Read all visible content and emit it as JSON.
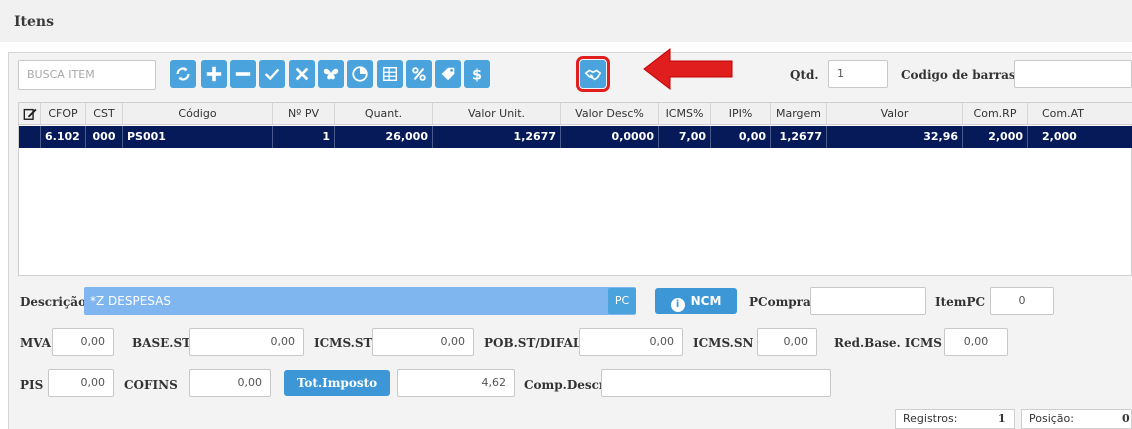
{
  "window": {
    "title": "Itens"
  },
  "toolbar": {
    "search_placeholder": "BUSCA ITEM",
    "buttons": [
      {
        "name": "refresh",
        "glyph": "⟳"
      },
      {
        "name": "add",
        "glyph": "+"
      },
      {
        "name": "remove",
        "glyph": "−"
      },
      {
        "name": "confirm",
        "glyph": "✓"
      },
      {
        "name": "cancel",
        "glyph": "✕"
      },
      {
        "name": "butterfly",
        "glyph": "⋈"
      },
      {
        "name": "chart",
        "glyph": "◔"
      },
      {
        "name": "excel",
        "glyph": "▤"
      },
      {
        "name": "percent",
        "glyph": "%"
      },
      {
        "name": "tag",
        "glyph": "◈"
      },
      {
        "name": "dollar",
        "glyph": "$"
      },
      {
        "name": "handshake",
        "glyph": "⚇"
      }
    ],
    "qtd_label": "Qtd.",
    "qtd_value": "1",
    "barcode_label": "Codigo de barras",
    "barcode_value": ""
  },
  "grid": {
    "columns": [
      "CFOP",
      "CST",
      "Código",
      "Nº PV",
      "Quant.",
      "Valor Unit.",
      "Valor Desc%",
      "ICMS%",
      "IPI%",
      "Margem",
      "Valor",
      "Com.RP",
      "Com.AT"
    ],
    "rows": [
      {
        "cfop": "6.102",
        "cst": "000",
        "codigo": "PS001",
        "npv": "1",
        "quant": "26,000",
        "valor_unit": "1,2677",
        "valor_desc": "0,0000",
        "icms": "7,00",
        "ipi": "0,00",
        "margem": "1,2677",
        "valor": "32,96",
        "com_rp": "2,000",
        "com_at": "2,000"
      }
    ]
  },
  "details": {
    "descricao_label": "Descrição",
    "descricao_value": "*Z DESPESAS",
    "unit": "PC",
    "ncm_label": "NCM",
    "pcompra_label": "PCompra",
    "pcompra_value": "",
    "itempc_label": "ItemPC",
    "itempc_value": "0",
    "mva_label": "MVA",
    "mva_value": "0,00",
    "basest_label": "BASE.ST",
    "basest_value": "0,00",
    "icmsst_label": "ICMS.ST",
    "icmsst_value": "0,00",
    "pobst_label": "POB.ST/DIFAL",
    "pobst_value": "0,00",
    "icmssn_label": "ICMS.SN",
    "icmssn_value": "0,00",
    "redbase_label": "Red.Base. ICMS",
    "redbase_value": "0,00",
    "pis_label": "PIS",
    "pis_value": "0,00",
    "cofins_label": "COFINS",
    "cofins_value": "0,00",
    "totimposto_label": "Tot.Imposto",
    "totimposto_value": "4,62",
    "compdescr_label": "Comp.Descr",
    "compdescr_value": ""
  },
  "status": {
    "registros_label": "Registros:",
    "registros_value": "1",
    "posicao_label": "Posição:",
    "posicao_value": "0"
  },
  "colors": {
    "accent": "#4aa3dd",
    "selected_row": "#061a5a",
    "highlight": "#e11e1e",
    "description_bar": "#7fb6f0"
  }
}
